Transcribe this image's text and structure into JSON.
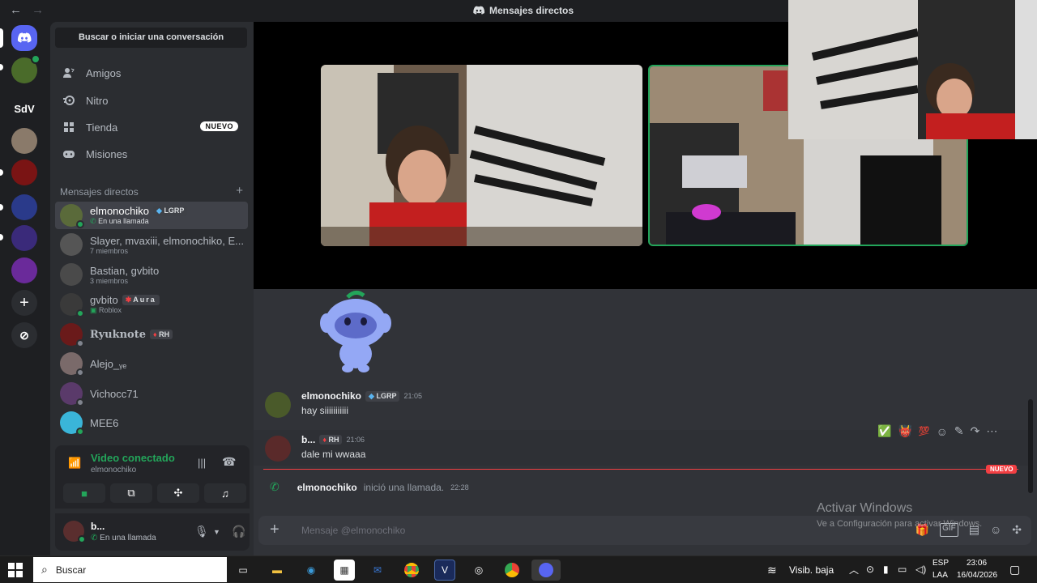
{
  "window": {
    "title": "Mensajes directos",
    "back_icon": "arrow-left-icon",
    "forward_icon": "arrow-right-icon"
  },
  "servers": [
    {
      "name": "discord-home",
      "label": "",
      "color": "#5865f2"
    },
    {
      "name": "server-1",
      "label": "",
      "color": "#4a6b2a"
    },
    {
      "name": "server-sdv",
      "label": "SdV",
      "color": "#1e1f22"
    },
    {
      "name": "server-3",
      "label": "",
      "color": "#8a7a6a"
    },
    {
      "name": "server-4",
      "label": "",
      "color": "#7a1414"
    },
    {
      "name": "server-allstars",
      "label": "",
      "color": "#2a3a8a"
    },
    {
      "name": "server-6",
      "label": "",
      "color": "#3a2a7a"
    },
    {
      "name": "server-7",
      "label": "",
      "color": "#6a2a9a"
    }
  ],
  "sidebar": {
    "search_label": "Buscar o iniciar una conversación",
    "nav": [
      {
        "label": "Amigos",
        "icon": "friends-icon"
      },
      {
        "label": "Nitro",
        "icon": "nitro-icon"
      },
      {
        "label": "Tienda",
        "icon": "shop-icon",
        "badge": "NUEVO"
      },
      {
        "label": "Misiones",
        "icon": "quests-icon"
      }
    ],
    "dm_header": "Mensajes directos",
    "dms": [
      {
        "name": "elmonochiko",
        "tag": "LGRP",
        "sub": "En una llamada",
        "active": true,
        "color": "#5a6a3a"
      },
      {
        "name": "Slayer, mvaxiii, elmonochiko, E...",
        "sub": "7 miembros",
        "color": "#555"
      },
      {
        "name": "Bastian, gvbito",
        "sub": "3 miembros",
        "color": "#4a4a4a"
      },
      {
        "name": "gvbito",
        "tag": "Aura",
        "sub": "Roblox",
        "color": "#3a3a3a"
      },
      {
        "name": "Ryuknote",
        "tag": "RH",
        "sub": "",
        "color": "#6a1a1a"
      },
      {
        "name": "Alejo_ᵧₑ",
        "sub": "",
        "color": "#7a6a6a"
      },
      {
        "name": "Vichocc71",
        "sub": "",
        "color": "#5a3a6a"
      },
      {
        "name": "MEE6",
        "sub": "",
        "color": "#3ab5d9"
      }
    ]
  },
  "voice": {
    "status": "Video conectado",
    "channel": "elmonochiko"
  },
  "user": {
    "name": "b...",
    "status": "En una llamada"
  },
  "messages": [
    {
      "author": "elmonochiko",
      "tag": "LGRP",
      "time": "21:05",
      "body": "hay siiiiiiiiiii",
      "color": "#4a5a2a"
    },
    {
      "author": "b...",
      "tag": "RH",
      "time": "21:06",
      "body": "dale mi wwaaa",
      "color": "#5a2a2a"
    }
  ],
  "new_label": "NUEVO",
  "call_event": {
    "author": "elmonochiko",
    "text": "inició una llamada.",
    "time": "22:28"
  },
  "composer": {
    "placeholder": "Mensaje @elmonochiko"
  },
  "watermark": {
    "title": "Activar Windows",
    "subtitle": "Ve a Configuración para activar Windows."
  },
  "taskbar": {
    "search_placeholder": "Buscar",
    "weather": "Visib. baja",
    "lang_1": "ESP",
    "lang_2": "LAA",
    "time": "23:06",
    "date": "16/04/2026"
  }
}
